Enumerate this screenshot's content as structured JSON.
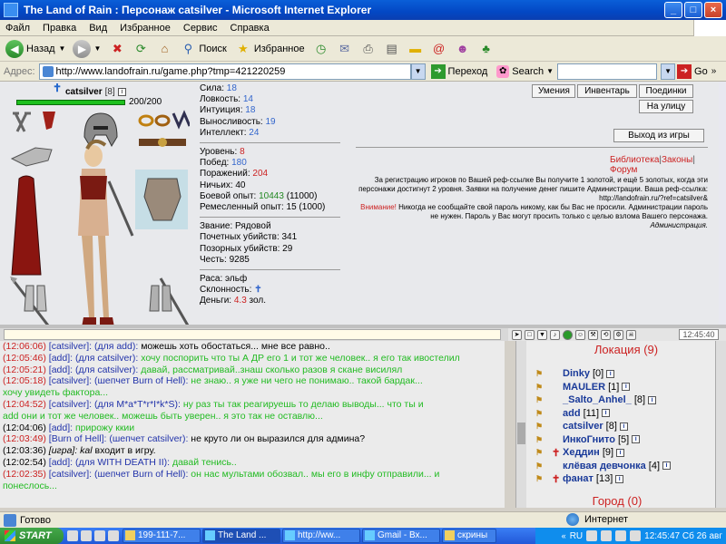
{
  "window": {
    "title": "The Land of Rain : Персонаж catsilver - Microsoft Internet Explorer"
  },
  "menu": [
    "Файл",
    "Правка",
    "Вид",
    "Избранное",
    "Сервис",
    "Справка"
  ],
  "toolbar": {
    "back": "Назад",
    "search": "Поиск",
    "favorites": "Избранное"
  },
  "address": {
    "label": "Адрес:",
    "url": "http://www.landofrain.ru/game.php?tmp=421220259",
    "go": "Переход",
    "search_label": "Search",
    "go2": "Go"
  },
  "character": {
    "name": "catsilver",
    "level": "[8]",
    "hp": "200/200",
    "hp_fraction": 1.0
  },
  "stats": {
    "strength": {
      "label": "Сила:",
      "value": "18"
    },
    "agility": {
      "label": "Ловкость:",
      "value": "14"
    },
    "intuition": {
      "label": "Интуиция:",
      "value": "18"
    },
    "stamina": {
      "label": "Выносливость:",
      "value": "19"
    },
    "intellect": {
      "label": "Интеллект:",
      "value": "24"
    },
    "level": {
      "label": "Уровень:",
      "value": "8"
    },
    "wins": {
      "label": "Побед:",
      "value": "180"
    },
    "losses": {
      "label": "Поражений:",
      "value": "204"
    },
    "draws": {
      "label": "Ничьих:",
      "value": "40"
    },
    "combat_exp": {
      "label": "Боевой опыт:",
      "value": "10443",
      "next": "(11000)"
    },
    "craft_exp": {
      "label": "Ремесленный опыт:",
      "value": "15 (1000)"
    },
    "rank": "Звание: Рядовой",
    "honor_kills": "Почетных убийств: 341",
    "shame_kills": "Позорных убийств: 29",
    "honor": "Честь: 9285",
    "race": "Раса: эльф",
    "alignment": "Склонность:",
    "money_label": "Деньги:",
    "money_value": "4.3",
    "money_unit": "зол."
  },
  "buttons": {
    "skills": "Умения",
    "inventory": "Инвентарь",
    "duels": "Поединки",
    "street": "На улицу",
    "exit": "Выход из игры"
  },
  "links": {
    "library": "Библиотека",
    "laws": "Законы",
    "forum": "Форум"
  },
  "notice": {
    "line1": "За регистрацию игроков по Вашей реф-ссылке Вы получите 1 золотой, и ещё 5 золотых, когда эти персонажи достигнут 2 уровня. Заявки на получение денег пишите Администрации. Ваша реф-ссылка: http://landofrain.ru/?ref=catsilver&",
    "warn_label": "Внимание!",
    "warn_text": " Никогда не сообщайте свой пароль никому, как бы Вас не просили. Администрации пароль не нужен. Пароль у Вас могут просить только с целью взлома Вашего персонажа.",
    "signature": "Администрация."
  },
  "chat": [
    {
      "time": "(12:06:06)",
      "color": "t-red",
      "text_parts": [
        {
          "c": "t-blue",
          "t": " [catsilver]: (для add): "
        },
        {
          "c": "t-black",
          "t": "можешь хоть обостаться... мне все равно.."
        }
      ]
    },
    {
      "time": "(12:05:46)",
      "color": "t-red",
      "text_parts": [
        {
          "c": "t-blue",
          "t": " [add]: (для catsilver): "
        },
        {
          "c": "t-green",
          "t": "хочу поспорить что ты А ДР его 1 и тот же человек.. я его так ивостелил"
        }
      ]
    },
    {
      "time": "(12:05:21)",
      "color": "t-red",
      "text_parts": [
        {
          "c": "t-blue",
          "t": " [add]: (для catsilver): "
        },
        {
          "c": "t-green",
          "t": "давай, рассматривай..знаш сколько разов я скане висилял"
        }
      ]
    },
    {
      "time": "(12:05:18)",
      "color": "t-red",
      "text_parts": [
        {
          "c": "t-blue",
          "t": " [catsilver]: (шепчет Burn of Hell): "
        },
        {
          "c": "t-green",
          "t": "не знаю.. я уже ни чего не понимаю.. такой бардак..."
        }
      ]
    },
    {
      "time": "",
      "color": "t-red",
      "text_parts": [
        {
          "c": "t-green",
          "t": "хочу увидеть фактора..."
        }
      ]
    },
    {
      "time": "(12:04:52)",
      "color": "t-red",
      "text_parts": [
        {
          "c": "t-blue",
          "t": " [catsilver]: (для M*a*T*r*I*k*S): "
        },
        {
          "c": "t-green",
          "t": "ну раз ты так реагируешь то делаю выводы... что ты и"
        }
      ]
    },
    {
      "time": "",
      "color": "t-red",
      "text_parts": [
        {
          "c": "t-green",
          "t": "add они и тот же человек.. можешь быть уверен.. я это так не оставлю..."
        }
      ]
    },
    {
      "time": "(12:04:06)",
      "color": "t-black",
      "text_parts": [
        {
          "c": "t-blue",
          "t": " [add]: "
        },
        {
          "c": "t-green",
          "t": "прирожу ккии"
        }
      ]
    },
    {
      "time": "(12:03:49)",
      "color": "t-red",
      "text_parts": [
        {
          "c": "t-blue",
          "t": " [Burn of Hell]: (шепчет catsilver): "
        },
        {
          "c": "t-black",
          "t": "не круто ли он выразился для админа?"
        }
      ]
    },
    {
      "time": "(12:03:36)",
      "color": "t-black",
      "text_parts": [
        {
          "c": "t-ital",
          "t": " [игра]: kal"
        },
        {
          "c": "t-black",
          "t": " входит в игру."
        }
      ]
    },
    {
      "time": "(12:02:54)",
      "color": "t-black",
      "text_parts": [
        {
          "c": "t-blue",
          "t": " [add]: (для WITH DEATH II): "
        },
        {
          "c": "t-green",
          "t": "давай тенись.."
        }
      ]
    },
    {
      "time": "(12:02:35)",
      "color": "t-red",
      "text_parts": [
        {
          "c": "t-blue",
          "t": " [catsilver]: (шепчет Burn of Hell): "
        },
        {
          "c": "t-green",
          "t": "он нас мультами обозвал.. мы его в инфу отправили... и"
        }
      ]
    },
    {
      "time": "",
      "color": "t-red",
      "text_parts": [
        {
          "c": "t-green",
          "t": "понеслось..."
        }
      ]
    }
  ],
  "clock": "12:45:40",
  "location": {
    "title": "Локация (9)",
    "players": [
      {
        "name": "Dinky",
        "level": "[0]",
        "mark": false
      },
      {
        "name": "MAULER",
        "level": "[1]",
        "mark": false
      },
      {
        "name": "_Salto_Anhel_",
        "level": "[8]",
        "mark": false
      },
      {
        "name": "add",
        "level": "[11]",
        "mark": false
      },
      {
        "name": "catsilver",
        "level": "[8]",
        "mark": false
      },
      {
        "name": "ИнкоГнито",
        "level": "[5]",
        "mark": false
      },
      {
        "name": "Хеддин",
        "level": "[9]",
        "mark": true
      },
      {
        "name": "клёвая девчонка",
        "level": "[4]",
        "mark": false
      },
      {
        "name": "фанат",
        "level": "[13]",
        "mark": true
      }
    ],
    "city_title": "Город (0)"
  },
  "status": {
    "left": "Готово",
    "zone": "Интернет"
  },
  "taskbar": {
    "start": "START",
    "tasks": [
      "199-111-7...",
      "The Land ...",
      "http://ww...",
      "Gmail - Вх...",
      "скрины"
    ],
    "lang": "RU",
    "time": "12:45:47 Сб 26 авг"
  },
  "colors": {
    "accent_red": "#cc2222",
    "accent_blue": "#3366cc",
    "green": "#22bb22"
  }
}
